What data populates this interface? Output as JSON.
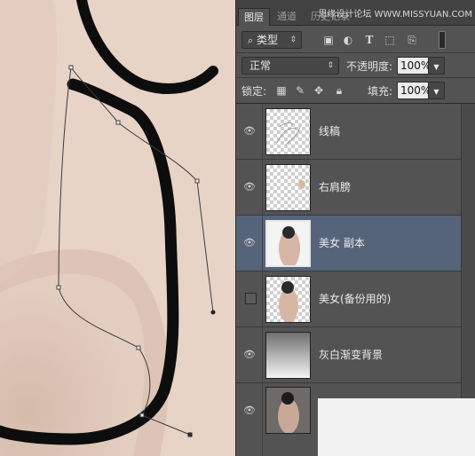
{
  "canvas": {
    "skin_color": "#e6d2c4",
    "shadow_color": "#c9aa97",
    "stroke_color": "#0d0d0d"
  },
  "tabs": [
    {
      "label": "图层",
      "active": true
    },
    {
      "label": "通道",
      "active": false
    },
    {
      "label": "历史记录",
      "active": false
    }
  ],
  "watermark": "思缘设计论坛 WWW.MISSYUAN.COM",
  "filter": {
    "kind_label": "类型",
    "icons": [
      "image-filter-icon",
      "adjustment-filter-icon",
      "type-filter-icon",
      "shape-filter-icon",
      "smart-object-filter-icon"
    ]
  },
  "blend": {
    "mode": "正常",
    "opacity_label": "不透明度:",
    "opacity_value": "100%"
  },
  "lock": {
    "label": "锁定:",
    "fill_label": "填充:",
    "fill_value": "100%"
  },
  "layers": [
    {
      "name": "线稿",
      "visible": true,
      "thumb": "transparent-sketch",
      "selected": false
    },
    {
      "name": "右肩膀",
      "visible": true,
      "thumb": "transparent-small",
      "selected": false
    },
    {
      "name": "美女 副本",
      "visible": true,
      "thumb": "photo",
      "selected": true
    },
    {
      "name": "美女(备份用的)",
      "visible": false,
      "thumb": "photo",
      "selected": false
    },
    {
      "name": "灰白渐变背景",
      "visible": true,
      "thumb": "gradient",
      "selected": false
    },
    {
      "name": "",
      "visible": true,
      "thumb": "photo-dark",
      "selected": false
    }
  ]
}
